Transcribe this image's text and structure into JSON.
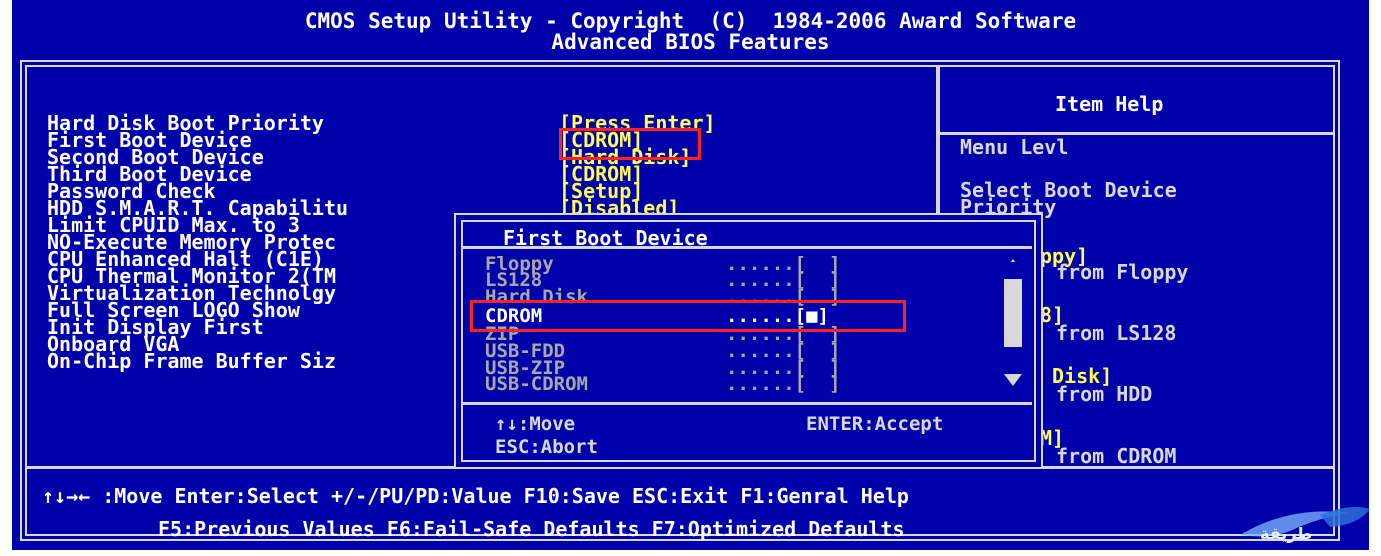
{
  "header": {
    "title_line1": "CMOS Setup Utility - Copyright  (C)  1984-2006 Award Software",
    "title_line2": "Advanced BIOS Features"
  },
  "settings": [
    {
      "label": "Hard Disk Boot Priority",
      "value": "[Press Enter]"
    },
    {
      "label": "First Boot Device",
      "value": "[CDROM]"
    },
    {
      "label": "Second Boot Device",
      "value": "[Hard Disk]"
    },
    {
      "label": "Third Boot Device",
      "value": "[CDROM]"
    },
    {
      "label": "Password Check",
      "value": "[Setup]"
    },
    {
      "label": "HDD S.M.A.R.T. Capabilitu",
      "value": "[Disabled]"
    },
    {
      "label": "Limit CPUID Max. to 3",
      "value": ""
    },
    {
      "label": "NO-Execute Memory Protec",
      "value": ""
    },
    {
      "label": "CPU Enhanced Halt (C1E)",
      "value": ""
    },
    {
      "label": "CPU Thermal Monitor 2(TM",
      "value": ""
    },
    {
      "label": "Virtualization Technolgy",
      "value": ""
    },
    {
      "label": "Full Screen LOGO Show",
      "value": ""
    },
    {
      "label": "Init Display First",
      "value": ""
    },
    {
      "label": "Onboard VGA",
      "value": ""
    },
    {
      "label": "On-Chip Frame Buffer Siz",
      "value": ""
    }
  ],
  "help": {
    "title": "Item Help",
    "menu_level": "Menu Levl",
    "select_line1": "Select Boot Device",
    "select_line2": "Priority",
    "entries": [
      {
        "name": "ppy]",
        "desc": "from Floppy"
      },
      {
        "name": "8]",
        "desc": "from LS128"
      },
      {
        "name": " Disk]",
        "desc": "from HDD"
      },
      {
        "name": "M]",
        "desc": "from CDROM"
      }
    ]
  },
  "popup": {
    "title": "First Boot Device",
    "options": [
      {
        "label": "Floppy",
        "marker": "......[  ]",
        "selected": false
      },
      {
        "label": "LS128",
        "marker": "......[  ]",
        "selected": false
      },
      {
        "label": "Hard Disk",
        "marker": "......[  ]",
        "selected": false
      },
      {
        "label": "CDROM",
        "marker": "......[■]",
        "selected": true
      },
      {
        "label": "ZIP",
        "marker": "......[  ]",
        "selected": false
      },
      {
        "label": "USB-FDD",
        "marker": "......[  ]",
        "selected": false
      },
      {
        "label": "USB-ZIP",
        "marker": "......[  ]",
        "selected": false
      },
      {
        "label": "USB-CDROM",
        "marker": "......[  ]",
        "selected": false
      }
    ],
    "move_hint": "↑↓:Move",
    "accept_hint": "ENTER:Accept",
    "abort_hint": "ESC:Abort"
  },
  "footer": {
    "line1": "↑↓→← :Move Enter:Select +/-/PU/PD:Value F10:Save ESC:Exit F1:Genral Help",
    "line2": "F5:Previous Values F6:Fail-Safe Defaults F7:Optimized Defaults"
  },
  "watermark": {
    "text": "طريقة"
  },
  "colors": {
    "background": "#0000aa",
    "text": "#ffffff",
    "value": "#ffff55",
    "highlight_box": "#ff2020"
  }
}
